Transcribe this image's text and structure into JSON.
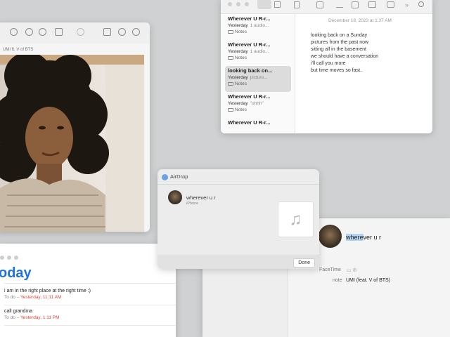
{
  "preview": {
    "subtitle": "UMI ft. V of BTS"
  },
  "notes": {
    "toolbar_glyph": "»",
    "items": [
      {
        "title": "Wherever U R-r...",
        "date": "Yesterday",
        "preview": "1 audio...",
        "folder": "Notes"
      },
      {
        "title": "Wherever U R-r...",
        "date": "Yesterday",
        "preview": "1 audio...",
        "folder": "Notes"
      },
      {
        "title": "looking back on...",
        "date": "Yesterday",
        "preview": "picture...",
        "folder": "Notes"
      },
      {
        "title": "Wherever U R-r...",
        "date": "Yesterday",
        "preview": "\"ohhh\"",
        "folder": "Notes"
      },
      {
        "title": "Wherever U R-r...",
        "date": "",
        "preview": "",
        "folder": ""
      }
    ],
    "date_header": "December 18, 2023 at 1:37 AM",
    "body_lines": [
      "looking back on a Sunday",
      "pictures from the past now",
      "sitting all in the basement",
      "we should have a conversation",
      "i'll call you more",
      "but time moves so fast.."
    ]
  },
  "airdrop": {
    "title": "AirDrop",
    "file_name": "wherever u r",
    "device": "iPhone",
    "file_icon": "music-note-icon",
    "music_glyph": "♫",
    "done_label": "Done"
  },
  "contact": {
    "name_highlight": "where",
    "name_rest": "ver u r",
    "facetime_label": "FaceTime",
    "facetime_icons": "▭  ✆",
    "note_label": "note",
    "note_value": "UMI (feat. V of BTS)"
  },
  "reminders": {
    "heading": "oday",
    "items": [
      {
        "title": "i am in the right place at the right time :)",
        "due_prefix": "To do – ",
        "due_when": "Yesterday, 11:11 AM"
      },
      {
        "title": "call grandma",
        "due_prefix": "To do – ",
        "due_when": "Yesterday, 1:11 PM"
      }
    ]
  },
  "colors": {
    "desktop": "#cfd1d2",
    "reminders_heading": "#1e74d9",
    "due_red": "#e0453a",
    "selection_highlight": "#b5d3f3"
  }
}
